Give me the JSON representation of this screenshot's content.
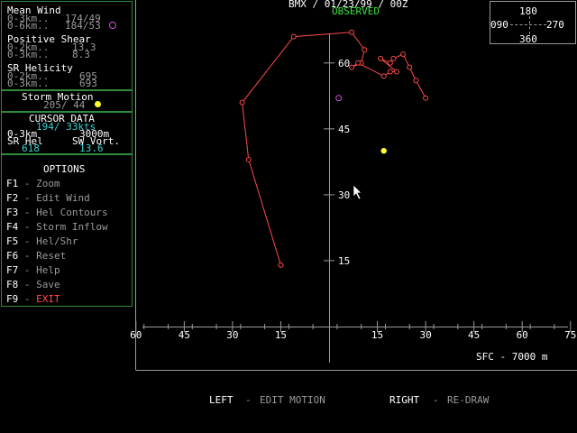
{
  "header": {
    "station": "BMX / 01/23/99 / 00Z",
    "mode": "OBSERVED"
  },
  "mean_wind": {
    "title": "Mean Wind",
    "row1_label": "0-3km..",
    "row1_value": "174/49",
    "row2_label": "0-6km..",
    "row2_value": "184/53"
  },
  "positive_shear": {
    "title": "Positive Shear",
    "row1_label": "0-2km..",
    "row1_value": "13.3",
    "row2_label": "0-3km..",
    "row2_value": "8.3"
  },
  "sr_helicity": {
    "title": "SR Helicity",
    "row1_label": "0-2km..",
    "row1_value": "695",
    "row2_label": "0-3km..",
    "row2_value": "693"
  },
  "storm_motion": {
    "title": "Storm Motion",
    "value": "205/ 44"
  },
  "cursor_data": {
    "title": "CURSOR DATA",
    "value": "194/ 33kts",
    "range_label": "0-3km",
    "depth": "3000m",
    "srhel_label": "SR Hel",
    "vort_label": "SW Vort.",
    "srhel_value": "618",
    "vort_value": "13.6"
  },
  "options": {
    "title": "OPTIONS",
    "items": [
      {
        "key": "F1",
        "label": "Zoom"
      },
      {
        "key": "F2",
        "label": "Edit Wind"
      },
      {
        "key": "F3",
        "label": "Hel Contours"
      },
      {
        "key": "F4",
        "label": "Storm Inflow"
      },
      {
        "key": "F5",
        "label": "Hel/Shr"
      },
      {
        "key": "F6",
        "label": "Reset"
      },
      {
        "key": "F7",
        "label": "Help"
      },
      {
        "key": "F8",
        "label": "Save"
      },
      {
        "key": "F9",
        "label": "EXIT"
      }
    ]
  },
  "compass": {
    "top": "180",
    "left": "090",
    "right": "270",
    "bottom": "360"
  },
  "plot": {
    "y_ticks": [
      "60",
      "45",
      "30",
      "15"
    ],
    "x_ticks": [
      "60",
      "45",
      "30",
      "15",
      "15",
      "30",
      "45",
      "60",
      "75"
    ],
    "height_label": "SFC - 7000 m",
    "hodograph_color": "#ff4a4a",
    "hodograph_uv": [
      [
        -15,
        14
      ],
      [
        -25,
        38
      ],
      [
        -27,
        51
      ],
      [
        -11,
        66
      ],
      [
        7,
        67
      ],
      [
        11,
        63
      ],
      [
        10,
        60
      ],
      [
        7,
        59
      ],
      [
        9,
        60
      ],
      [
        17,
        57
      ],
      [
        19,
        58
      ],
      [
        21,
        58
      ],
      [
        16,
        61
      ],
      [
        19,
        60
      ],
      [
        20,
        61
      ],
      [
        23,
        62
      ],
      [
        25,
        59
      ],
      [
        27,
        56
      ],
      [
        30,
        52
      ]
    ],
    "storm_motion_uv": [
      17,
      40
    ],
    "mean_wind_uv": [
      3,
      52
    ]
  },
  "footer": {
    "left_key": "LEFT",
    "left_action": "EDIT MOTION",
    "right_key": "RIGHT",
    "right_action": "RE-DRAW"
  }
}
